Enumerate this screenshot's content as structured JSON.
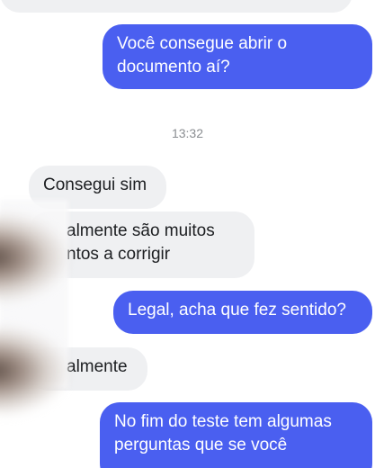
{
  "conversation": {
    "messages": [
      {
        "direction": "outgoing",
        "lines": [
          "Você consegue abrir o",
          "documento aí?"
        ]
      },
      {
        "type": "timestamp",
        "text": "13:32"
      },
      {
        "direction": "incoming",
        "lines": [
          "Consegui sim"
        ]
      },
      {
        "direction": "incoming",
        "lines": [
          "almente são muitos",
          "ntos a corrigir"
        ]
      },
      {
        "direction": "outgoing",
        "lines": [
          "Legal, acha que fez sentido?"
        ]
      },
      {
        "direction": "incoming",
        "lines": [
          "almente"
        ]
      },
      {
        "direction": "outgoing",
        "lines": [
          "No fim do teste tem algumas",
          "perguntas que se você"
        ]
      }
    ]
  },
  "colors": {
    "outgoing_bubble": "#4a5ff0",
    "incoming_bubble": "#eff0f2",
    "timestamp_text": "#8a8d91"
  }
}
